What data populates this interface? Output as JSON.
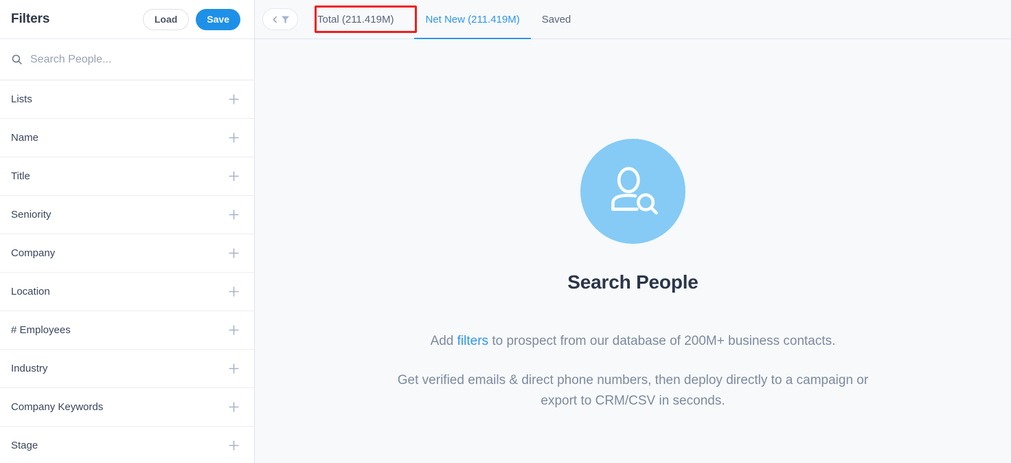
{
  "sidebar": {
    "title": "Filters",
    "load_label": "Load",
    "save_label": "Save",
    "search": {
      "placeholder": "Search People...",
      "value": "",
      "icon": "search-icon"
    },
    "items": [
      {
        "label": "Lists",
        "action_icon": "plus-icon"
      },
      {
        "label": "Name",
        "action_icon": "plus-icon"
      },
      {
        "label": "Title",
        "action_icon": "plus-icon"
      },
      {
        "label": "Seniority",
        "action_icon": "plus-icon"
      },
      {
        "label": "Company",
        "action_icon": "plus-icon"
      },
      {
        "label": "Location",
        "action_icon": "plus-icon"
      },
      {
        "label": "# Employees",
        "action_icon": "plus-icon"
      },
      {
        "label": "Industry",
        "action_icon": "plus-icon"
      },
      {
        "label": "Company Keywords",
        "action_icon": "plus-icon"
      },
      {
        "label": "Stage",
        "action_icon": "plus-icon"
      }
    ]
  },
  "tabbar": {
    "collapse_button": {
      "chevron_icon": "chevron-left-icon",
      "funnel_icon": "funnel-icon"
    },
    "tabs": [
      {
        "label": "Total (211.419M)",
        "active": false,
        "highlighted": true
      },
      {
        "label": "Net New (211.419M)",
        "active": true,
        "highlighted": false
      },
      {
        "label": "Saved",
        "active": false,
        "highlighted": false
      }
    ]
  },
  "empty_state": {
    "illustration_icon": "person-search-icon",
    "title": "Search People",
    "line1_prefix": "Add ",
    "line1_link": "filters",
    "line1_suffix": " to prospect from our database of 200M+ business contacts.",
    "line2": "Get verified emails & direct phone numbers, then deploy directly to a campaign or export to CRM/CSV in seconds."
  },
  "colors": {
    "accent_blue": "#2f96e8",
    "save_blue": "#1e90e8",
    "illustration_blue": "#85cbf5",
    "highlight_red": "#f21c1c",
    "body_text": "#7d8a9e",
    "heading": "#2b3549",
    "main_bg": "#f7f9fb",
    "sidebar_bg": "#ffffff"
  }
}
